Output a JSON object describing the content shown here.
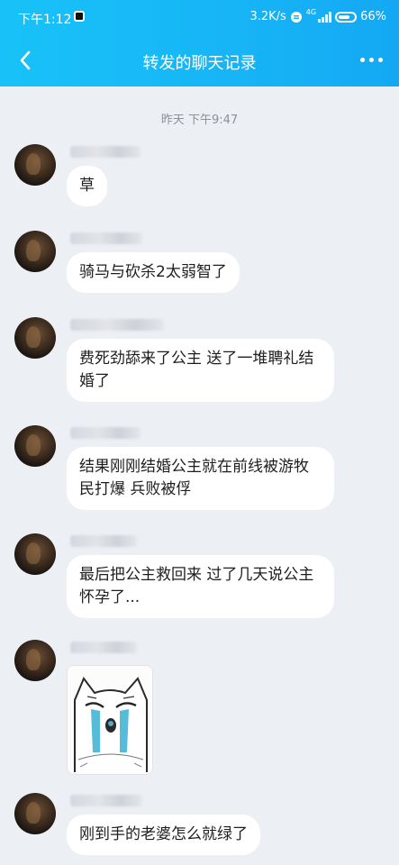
{
  "status_bar": {
    "time": "下午1:12",
    "net_speed": "3.2K/s",
    "net_type": "4G",
    "battery": "66%"
  },
  "header": {
    "title": "转发的聊天记录",
    "back_icon": "chevron-left-icon",
    "more_icon": "more-horizontal-icon"
  },
  "chat": {
    "timestamp": "昨天 下午9:47",
    "messages": [
      {
        "text": "草"
      },
      {
        "text": "骑马与砍杀2太弱智了"
      },
      {
        "text": "费死劲舔来了公主 送了一堆聘礼结婚了"
      },
      {
        "text": "结果刚刚结婚公主就在前线被游牧民打爆 兵败被俘"
      },
      {
        "text": "最后把公主救回来 过了几天说公主怀孕了..."
      },
      {
        "image": "crying-cat-meme"
      },
      {
        "text": "刚到手的老婆怎么就绿了"
      }
    ]
  }
}
